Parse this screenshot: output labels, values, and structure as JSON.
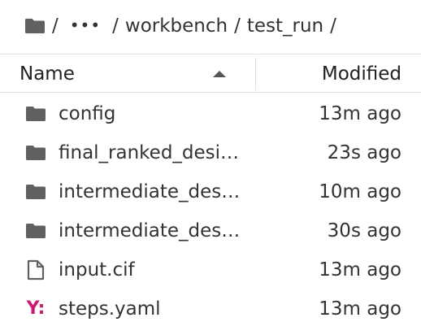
{
  "breadcrumb": {
    "root_icon": "folder-icon",
    "sep1": "/",
    "ellipsis": "•••",
    "sep2": "/",
    "folder1": "workbench",
    "sep3": "/",
    "folder2": "test_run",
    "sep4": "/"
  },
  "table": {
    "columns": {
      "name": "Name",
      "modified": "Modified",
      "sort": "ascending"
    },
    "rows": [
      {
        "icon": "folder-icon",
        "name": "config",
        "modified": "13m ago"
      },
      {
        "icon": "folder-icon",
        "name": "final_ranked_desi…",
        "modified": "23s ago"
      },
      {
        "icon": "folder-icon",
        "name": "intermediate_des…",
        "modified": "10m ago"
      },
      {
        "icon": "folder-icon",
        "name": "intermediate_des…",
        "modified": "30s ago"
      },
      {
        "icon": "file-icon",
        "name": "input.cif",
        "modified": "13m ago"
      },
      {
        "icon": "yaml-icon",
        "icon_text": "Y:",
        "name": "steps.yaml",
        "modified": "13m ago"
      }
    ]
  },
  "colors": {
    "folder_icon": "#616161",
    "yaml_icon": "#cb1a72",
    "border": "#e0e0e0"
  }
}
